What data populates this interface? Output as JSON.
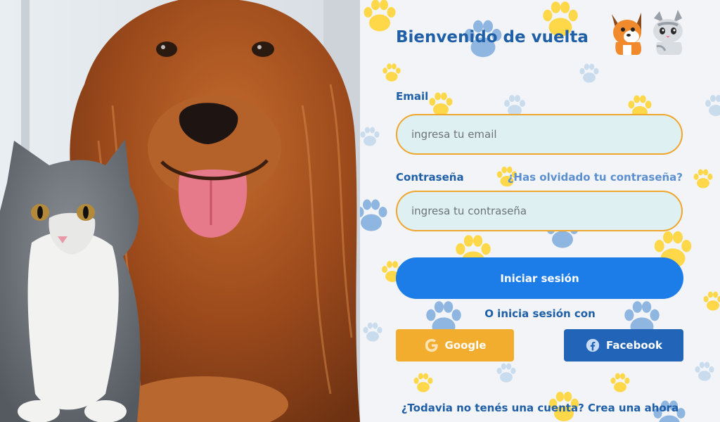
{
  "hero": {
    "image": "golden retriever dog with grey and white kitten"
  },
  "login": {
    "title": "Bienvenido de vuelta",
    "logo_icon": "dog-and-cat-icon",
    "email": {
      "label": "Email",
      "placeholder": "ingresa tu email",
      "value": ""
    },
    "password": {
      "label": "Contraseña",
      "placeholder": "ingresa tu contraseña",
      "value": ""
    },
    "forgot_password": "¿Has olvidado tu contraseña?",
    "submit_label": "Iniciar sesión",
    "alt_login_label": "O inicia sesión con",
    "google_label": "Google",
    "facebook_label": "Facebook",
    "signup_link": "¿Todavia no tenés una cuenta? Crea una ahora"
  },
  "colors": {
    "accent_blue": "#1c7ce8",
    "text_blue": "#1f5fa8",
    "field_border": "#f0a52c",
    "field_fill": "#dff0f3",
    "google": "#f2ad2e",
    "facebook": "#2164b8",
    "paw_yellow": "#ffd84a",
    "paw_blue": "#8fb6e0"
  }
}
